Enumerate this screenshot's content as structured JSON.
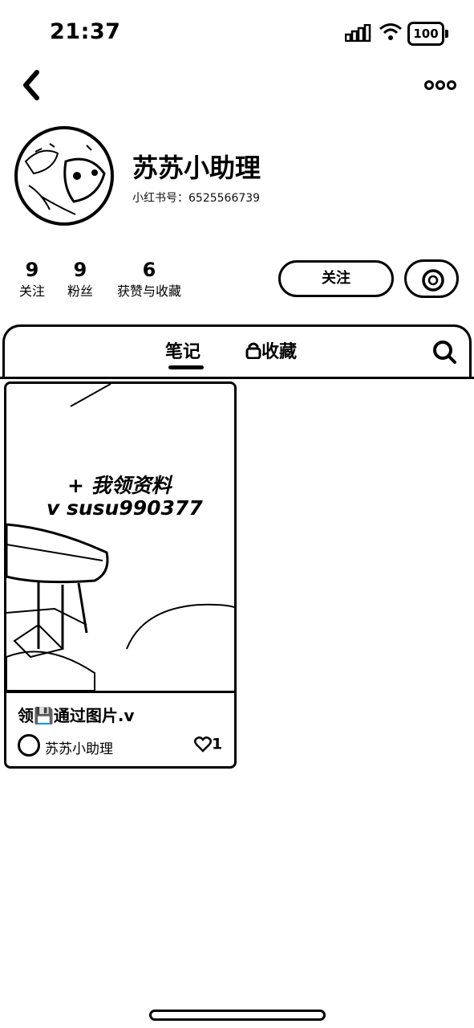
{
  "status_bar": {
    "time": "21:37",
    "battery": "100"
  },
  "profile": {
    "name": "苏苏小助理",
    "red_id": "小红书号：6525566739"
  },
  "stats": [
    {
      "value": "9",
      "label": "关注"
    },
    {
      "value": "9",
      "label": "粉丝"
    },
    {
      "value": "6",
      "label": "获赞与收藏"
    }
  ],
  "actions": {
    "follow": "关注"
  },
  "tabs": {
    "notes": "笔记",
    "collections": "收藏"
  },
  "notes": [
    {
      "cover_line1": "+ 我领资料",
      "cover_line2": "v  susu990377",
      "title": "领💾通过图片.v",
      "author": "苏苏小助理",
      "likes": "1"
    }
  ]
}
